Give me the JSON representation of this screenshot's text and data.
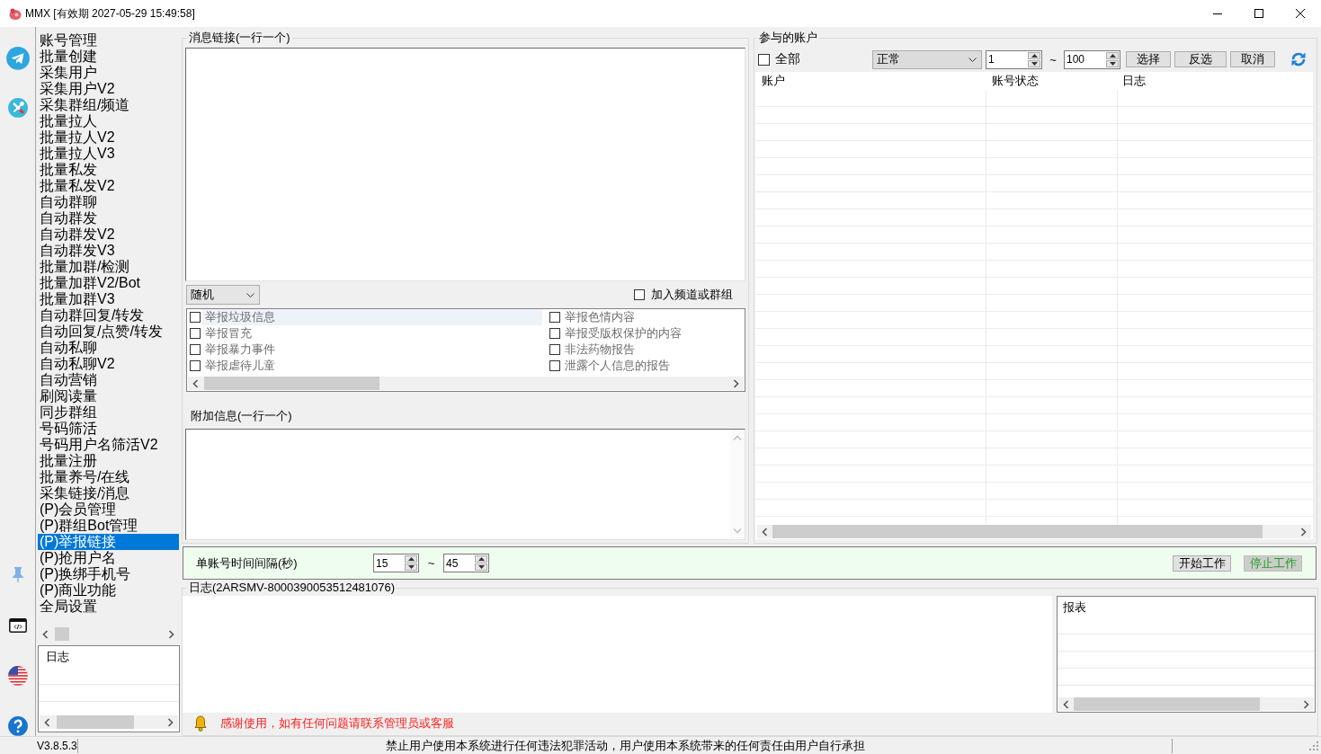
{
  "window": {
    "title": "MMX [有效期 2027-05-29 15:49:58]"
  },
  "sidebar": {
    "items": [
      {
        "label": "账号管理",
        "selected": false
      },
      {
        "label": "批量创建",
        "selected": false
      },
      {
        "label": "采集用户",
        "selected": false
      },
      {
        "label": "采集用户V2",
        "selected": false
      },
      {
        "label": "采集群组/频道",
        "selected": false
      },
      {
        "label": "批量拉人",
        "selected": false
      },
      {
        "label": "批量拉人V2",
        "selected": false
      },
      {
        "label": "批量拉人V3",
        "selected": false
      },
      {
        "label": "批量私发",
        "selected": false
      },
      {
        "label": "批量私发V2",
        "selected": false
      },
      {
        "label": "自动群聊",
        "selected": false
      },
      {
        "label": "自动群发",
        "selected": false
      },
      {
        "label": "自动群发V2",
        "selected": false
      },
      {
        "label": "自动群发V3",
        "selected": false
      },
      {
        "label": "批量加群/检测",
        "selected": false
      },
      {
        "label": "批量加群V2/Bot",
        "selected": false
      },
      {
        "label": "批量加群V3",
        "selected": false
      },
      {
        "label": "自动群回复/转发",
        "selected": false
      },
      {
        "label": "自动回复/点赞/转发",
        "selected": false
      },
      {
        "label": "自动私聊",
        "selected": false
      },
      {
        "label": "自动私聊V2",
        "selected": false
      },
      {
        "label": "自动营销",
        "selected": false
      },
      {
        "label": "刷阅读量",
        "selected": false
      },
      {
        "label": "同步群组",
        "selected": false
      },
      {
        "label": "号码筛活",
        "selected": false
      },
      {
        "label": "号码用户名筛活V2",
        "selected": false
      },
      {
        "label": "批量注册",
        "selected": false
      },
      {
        "label": "批量养号/在线",
        "selected": false
      },
      {
        "label": "采集链接/消息",
        "selected": false
      },
      {
        "label": "(P)会员管理",
        "selected": false
      },
      {
        "label": "(P)群组Bot管理",
        "selected": false
      },
      {
        "label": "(P)举报链接",
        "selected": true
      },
      {
        "label": "(P)抢用户名",
        "selected": false
      },
      {
        "label": "(P)换绑手机号",
        "selected": false
      },
      {
        "label": "(P)商业功能",
        "selected": false
      },
      {
        "label": "全局设置",
        "selected": false
      }
    ],
    "log_list": {
      "header": "日志"
    }
  },
  "message_links": {
    "label": "消息链接(一行一个)",
    "mode_dropdown": {
      "value": "随机"
    },
    "join_checkbox": {
      "label": "加入频道或群组",
      "checked": false
    },
    "report_reasons": [
      {
        "label": "举报垃圾信息",
        "checked": false,
        "selected": true
      },
      {
        "label": "举报冒充",
        "checked": false,
        "selected": false
      },
      {
        "label": "举报暴力事件",
        "checked": false,
        "selected": false
      },
      {
        "label": "举报虐待儿童",
        "checked": false,
        "selected": false
      },
      {
        "label": "举报色情内容",
        "checked": false,
        "selected": false
      },
      {
        "label": "举报受版权保护的内容",
        "checked": false,
        "selected": false
      },
      {
        "label": "非法药物报告",
        "checked": false,
        "selected": false
      },
      {
        "label": "泄露个人信息的报告",
        "checked": false,
        "selected": false
      }
    ]
  },
  "extra_info": {
    "label": "附加信息(一行一个)"
  },
  "accounts": {
    "label": "参与的账户",
    "all_checkbox": {
      "label": "全部",
      "checked": false
    },
    "status_dropdown": {
      "value": "正常"
    },
    "range_from": "1",
    "range_separator": "~",
    "range_to": "100",
    "buttons": [
      "选择",
      "反选",
      "取消"
    ],
    "table": {
      "columns": [
        "账户",
        "账号状态",
        "日志"
      ]
    }
  },
  "interval": {
    "label": "单账号时间间隔(秒)",
    "from": "15",
    "separator": "~",
    "to": "45",
    "buttons": [
      {
        "label": "开始工作",
        "disabled": false,
        "color": "#000000"
      },
      {
        "label": "停止工作",
        "disabled": true,
        "color": "#1ca01c"
      }
    ]
  },
  "log": {
    "title": "日志(2ARSMV-8000390053512481076)",
    "report_header": "报表",
    "notice": "感谢使用，如有任何问题请联系管理员或客服"
  },
  "status_bar": {
    "version": "V3.8.5.3",
    "message": "禁止用户使用本系统进行任何违法犯罪活动，用户使用本系统带来的任何责任由用户自行承担"
  }
}
